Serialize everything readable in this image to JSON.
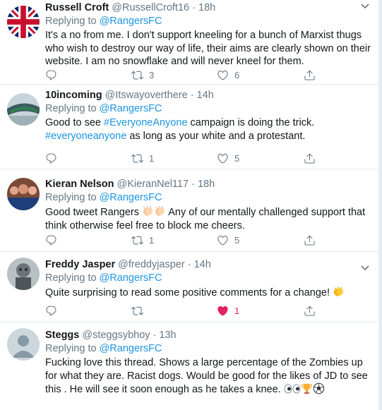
{
  "tweets": [
    {
      "name": "Russell Croft",
      "handle": "@RussellCroft16",
      "time": "18h",
      "replying_prefix": "Replying to",
      "replying_to": "@RangersFC",
      "text": "It's a no from me. I don't support kneeling for a bunch of Marxist thugs who wish to destroy our way of life, their aims are clearly shown on their website. I am no snowflake and will never kneel for them.",
      "retweets": "3",
      "likes": "6",
      "liked": false,
      "avatar": "union-jack-flag"
    },
    {
      "name": "10incoming",
      "handle": "@Itswayoverthere",
      "time": "14h",
      "replying_prefix": "Replying to",
      "replying_to": "@RangersFC",
      "text_parts": [
        "Good to see ",
        "#EveryoneAnyone",
        " campaign is doing the trick. ",
        "#everyoneanyone",
        " as long as your white and a protestant."
      ],
      "retweets": "1",
      "likes": "5",
      "liked": false,
      "avatar": "stadium-photo"
    },
    {
      "name": "Kieran Nelson",
      "handle": "@KieranNel117",
      "time": "18h",
      "replying_prefix": "Replying to",
      "replying_to": "@RangersFC",
      "text_before": "Good tweet Rangers",
      "emoji": "clapping-hands",
      "text_after": " Any of our mentally challenged support that think otherwise feel free to block me cheers.",
      "retweets": "1",
      "likes": "5",
      "liked": false,
      "avatar": "group-photo"
    },
    {
      "name": "Freddy Jasper",
      "handle": "@freddyjasper",
      "time": "14h",
      "replying_prefix": "Replying to",
      "replying_to": "@RangersFC",
      "text_before": "Quite surprising to read some positive comments for a change!",
      "emoji": "clapping-hands",
      "likes": "1",
      "liked": true,
      "avatar": "statue-photo"
    },
    {
      "name": "Steggs",
      "handle": "@steggsybhoy",
      "time": "13h",
      "replying_prefix": "Replying to",
      "replying_to": "@RangersFC",
      "text_before": "Fucking love this thread. Shows a large percentage of the Zombies up for what they are. Racist dogs.  Would be good for the likes of JD to see this . He will see it soon enough as he takes a knee.",
      "emojis": [
        "eyes",
        "trophy",
        "soccer-ball"
      ],
      "avatar": "default-egg"
    }
  ],
  "colors": {
    "link": "#1b95e0",
    "muted": "#657786",
    "text": "#14171a",
    "like": "#e0245e",
    "border": "#e6ecf0"
  }
}
